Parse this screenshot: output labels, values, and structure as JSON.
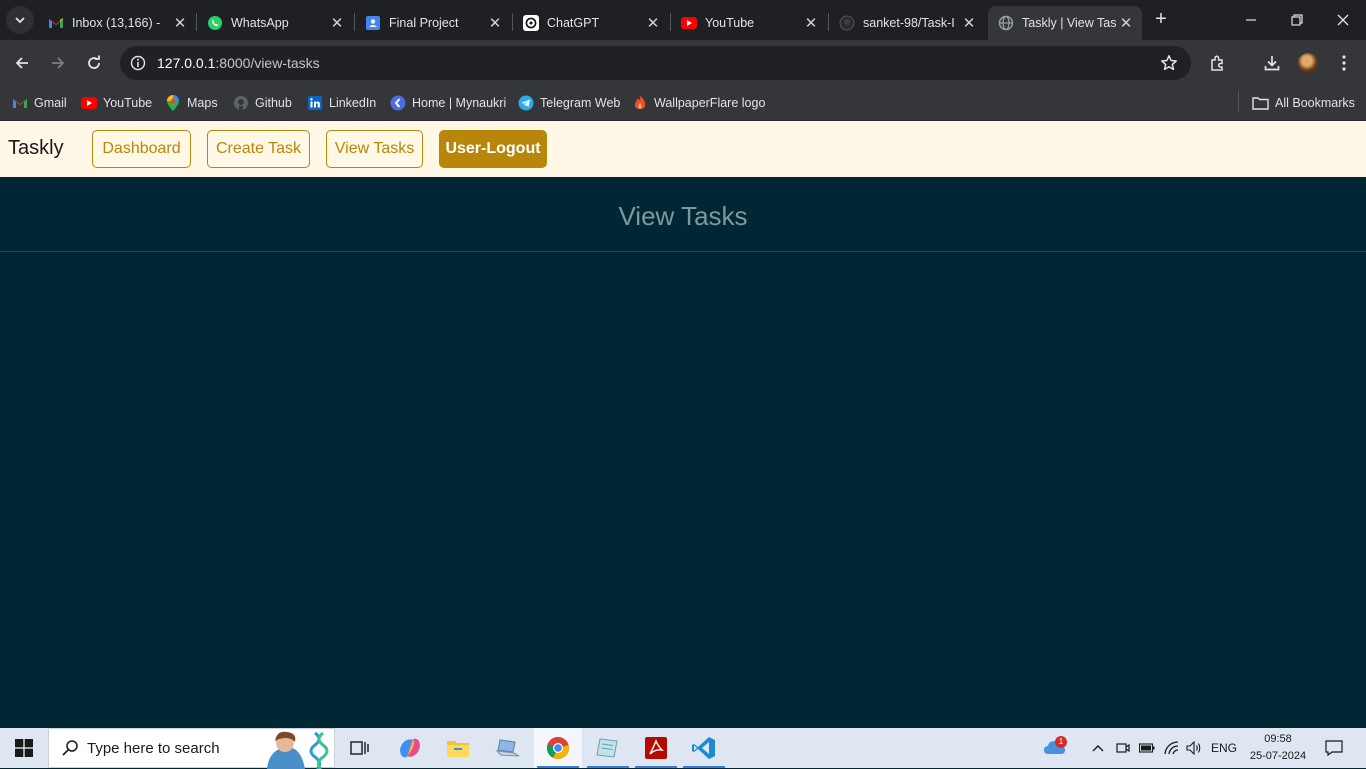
{
  "browser": {
    "tabs": [
      {
        "title": "Inbox (13,166) -",
        "icon": "gmail-icon"
      },
      {
        "title": "WhatsApp",
        "icon": "whatsapp-icon"
      },
      {
        "title": "Final Project",
        "icon": "docs-icon"
      },
      {
        "title": "ChatGPT",
        "icon": "chatgpt-icon"
      },
      {
        "title": "YouTube",
        "icon": "youtube-icon"
      },
      {
        "title": "sanket-98/Task-I",
        "icon": "github-icon"
      },
      {
        "title": "Taskly | View Tas",
        "icon": "globe-icon",
        "active": true
      }
    ],
    "url_host": "127.0.0.1",
    "url_path": ":8000/view-tasks",
    "bookmarks": [
      {
        "label": "Gmail",
        "icon": "gmail-icon"
      },
      {
        "label": "YouTube",
        "icon": "youtube-icon"
      },
      {
        "label": "Maps",
        "icon": "maps-icon"
      },
      {
        "label": "Github",
        "icon": "github-icon"
      },
      {
        "label": "LinkedIn",
        "icon": "linkedin-icon"
      },
      {
        "label": "Home | Mynaukri",
        "icon": "naukri-icon"
      },
      {
        "label": "Telegram Web",
        "icon": "telegram-icon"
      },
      {
        "label": "WallpaperFlare logo",
        "icon": "flame-icon"
      }
    ],
    "all_bookmarks": "All Bookmarks"
  },
  "page": {
    "brand": "Taskly",
    "nav": {
      "dashboard": "Dashboard",
      "create_task": "Create Task",
      "view_tasks": "View Tasks",
      "logout": "User-Logout"
    },
    "title": "View Tasks"
  },
  "taskbar": {
    "search_placeholder": "Type here to search",
    "notification_badge": "1",
    "language": "ENG",
    "time": "09:58",
    "date": "25-07-2024"
  },
  "colors": {
    "page_bg": "#002733",
    "navbar_bg": "#fff8e6",
    "accent": "#b8860b",
    "title": "#7a9aa0"
  }
}
